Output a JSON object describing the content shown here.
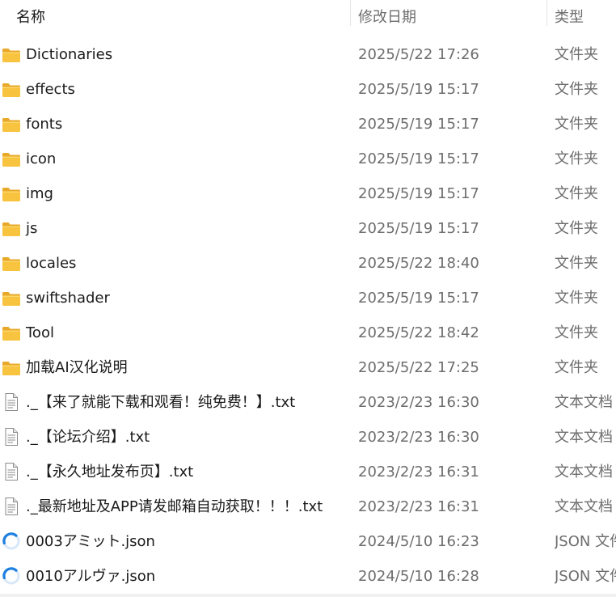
{
  "columns": {
    "name": "名称",
    "date": "修改日期",
    "type": "类型"
  },
  "colors": {
    "folder": "#f8c440",
    "header_text": "#4c607a",
    "secondary_text": "#6d6d6d"
  },
  "files": [
    {
      "name": "Dictionaries",
      "date": "2025/5/22 17:26",
      "type": "文件夹",
      "icon": "folder-icon"
    },
    {
      "name": "effects",
      "date": "2025/5/19 15:17",
      "type": "文件夹",
      "icon": "folder-icon"
    },
    {
      "name": "fonts",
      "date": "2025/5/19 15:17",
      "type": "文件夹",
      "icon": "folder-icon"
    },
    {
      "name": "icon",
      "date": "2025/5/19 15:17",
      "type": "文件夹",
      "icon": "folder-icon"
    },
    {
      "name": "img",
      "date": "2025/5/19 15:17",
      "type": "文件夹",
      "icon": "folder-icon"
    },
    {
      "name": "js",
      "date": "2025/5/19 15:17",
      "type": "文件夹",
      "icon": "folder-icon"
    },
    {
      "name": "locales",
      "date": "2025/5/22 18:40",
      "type": "文件夹",
      "icon": "folder-icon"
    },
    {
      "name": "swiftshader",
      "date": "2025/5/19 15:17",
      "type": "文件夹",
      "icon": "folder-icon"
    },
    {
      "name": "Tool",
      "date": "2025/5/22 18:42",
      "type": "文件夹",
      "icon": "folder-icon"
    },
    {
      "name": "加载AI汉化说明",
      "date": "2025/5/22 17:25",
      "type": "文件夹",
      "icon": "folder-icon"
    },
    {
      "name": "._【来了就能下载和观看！纯免费！】.txt",
      "date": "2023/2/23 16:30",
      "type": "文本文档",
      "icon": "text-file-icon"
    },
    {
      "name": "._【论坛介绍】.txt",
      "date": "2023/2/23 16:30",
      "type": "文本文档",
      "icon": "text-file-icon"
    },
    {
      "name": "._【永久地址发布页】.txt",
      "date": "2023/2/23 16:31",
      "type": "文本文档",
      "icon": "text-file-icon"
    },
    {
      "name": "._最新地址及APP请发邮箱自动获取！！！.txt",
      "date": "2023/2/23 16:31",
      "type": "文本文档",
      "icon": "text-file-icon"
    },
    {
      "name": "0003アミット.json",
      "date": "2024/5/10 16:23",
      "type": "JSON 文件",
      "icon": "json-file-icon"
    },
    {
      "name": "0010アルヴァ.json",
      "date": "2024/5/10 16:28",
      "type": "JSON 文件",
      "icon": "json-file-icon"
    }
  ]
}
